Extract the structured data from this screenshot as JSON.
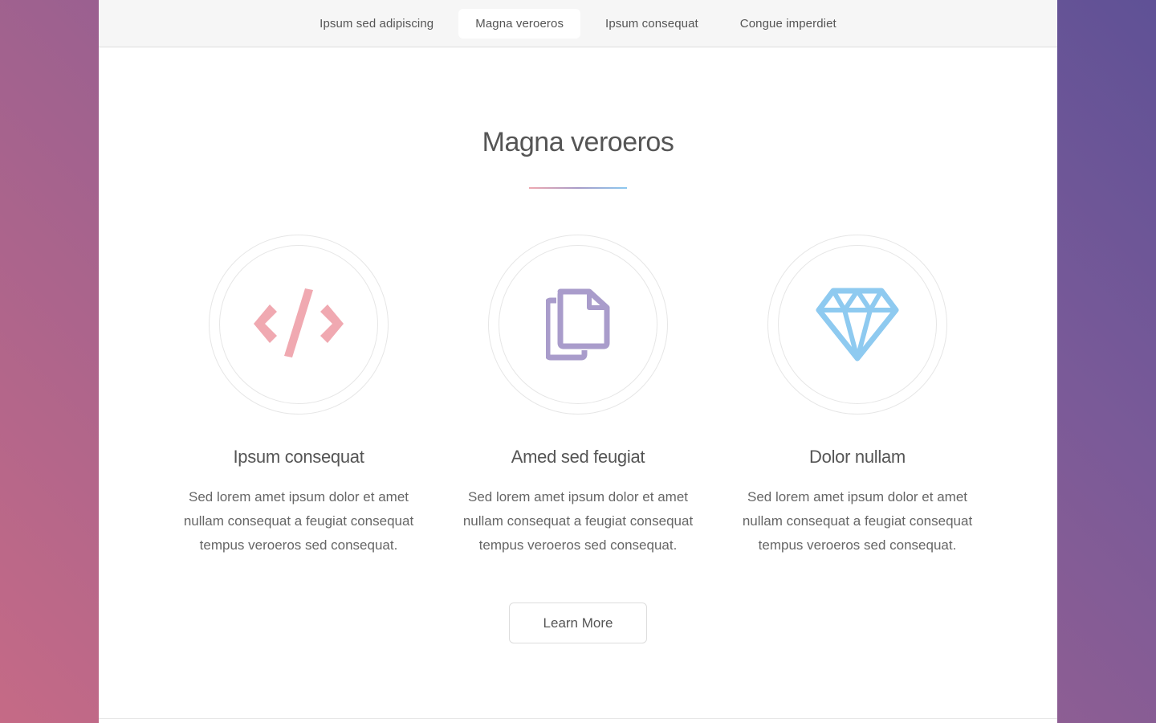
{
  "nav": {
    "items": [
      {
        "label": "Ipsum sed adipiscing",
        "active": false
      },
      {
        "label": "Magna veroeros",
        "active": true
      },
      {
        "label": "Ipsum consequat",
        "active": false
      },
      {
        "label": "Congue imperdiet",
        "active": false
      }
    ]
  },
  "section": {
    "title": "Magna veroeros",
    "rule_colors": [
      "#efa8b0",
      "#a89cc8",
      "#8cc9f0"
    ]
  },
  "features": [
    {
      "icon": "code-icon",
      "icon_color": "#f0a9b1",
      "title": "Ipsum consequat",
      "text": "Sed lorem amet ipsum dolor et amet nullam consequat a feugiat consequat tempus veroeros sed consequat."
    },
    {
      "icon": "copy-icon",
      "icon_color": "#a99ccb",
      "title": "Amed sed feugiat",
      "text": "Sed lorem amet ipsum dolor et amet nullam consequat a feugiat consequat tempus veroeros sed consequat."
    },
    {
      "icon": "diamond-icon",
      "icon_color": "#8ecaf0",
      "title": "Dolor nullam",
      "text": "Sed lorem amet ipsum dolor et amet nullam consequat a feugiat consequat tempus veroeros sed consequat."
    }
  ],
  "cta": {
    "label": "Learn More"
  }
}
